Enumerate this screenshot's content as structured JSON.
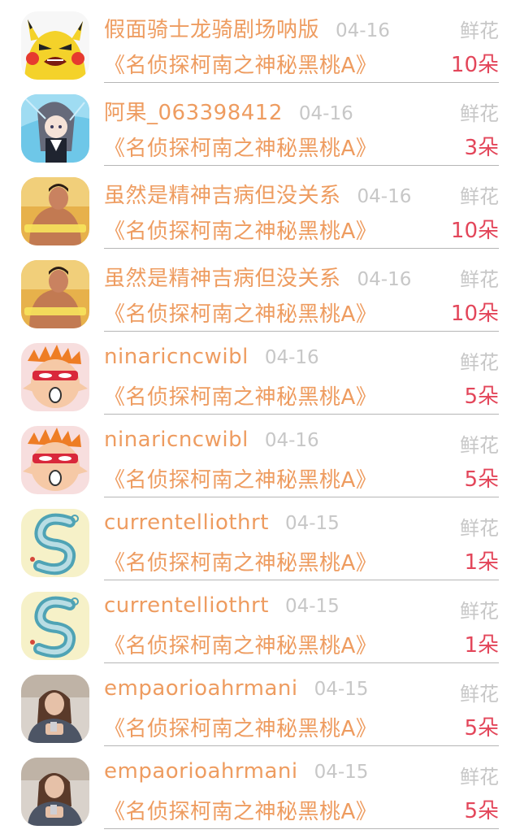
{
  "colors": {
    "accent_orange": "#ee9c60",
    "count_red": "#e3465a",
    "muted_gray": "#c7c7c7",
    "divider": "#b6b6b6"
  },
  "gifts": [
    {
      "user": "假面骑士龙骑剧场呐版",
      "date": "04-16",
      "gift": "鲜花",
      "work": "《名侦探柯南之神秘黑桃A》",
      "count": "10朵",
      "avatar_icon": "pikachu-avatar-icon"
    },
    {
      "user": "阿果_063398412",
      "date": "04-16",
      "gift": "鲜花",
      "work": "《名侦探柯南之神秘黑桃A》",
      "count": "3朵",
      "avatar_icon": "anime-girl-avatar-icon"
    },
    {
      "user": "虽然是精神吉病但没关系",
      "date": "04-16",
      "gift": "鲜花",
      "work": "《名侦探柯南之神秘黑桃A》",
      "count": "10朵",
      "avatar_icon": "man-photo-avatar-icon"
    },
    {
      "user": "虽然是精神吉病但没关系",
      "date": "04-16",
      "gift": "鲜花",
      "work": "《名侦探柯南之神秘黑桃A》",
      "count": "10朵",
      "avatar_icon": "man-photo-avatar-icon"
    },
    {
      "user": "ninaricncwibl",
      "date": "04-16",
      "gift": "鲜花",
      "work": "《名侦探柯南之神秘黑桃A》",
      "count": "5朵",
      "avatar_icon": "cartoon-face-avatar-icon"
    },
    {
      "user": "ninaricncwibl",
      "date": "04-16",
      "gift": "鲜花",
      "work": "《名侦探柯南之神秘黑桃A》",
      "count": "5朵",
      "avatar_icon": "cartoon-face-avatar-icon"
    },
    {
      "user": "currentelliothrt",
      "date": "04-15",
      "gift": "鲜花",
      "work": "《名侦探柯南之神秘黑桃A》",
      "count": "1朵",
      "avatar_icon": "letter-s-avatar-icon"
    },
    {
      "user": "currentelliothrt",
      "date": "04-15",
      "gift": "鲜花",
      "work": "《名侦探柯南之神秘黑桃A》",
      "count": "1朵",
      "avatar_icon": "letter-s-avatar-icon"
    },
    {
      "user": "empaorioahrmani",
      "date": "04-15",
      "gift": "鲜花",
      "work": "《名侦探柯南之神秘黑桃A》",
      "count": "5朵",
      "avatar_icon": "woman-photo-avatar-icon"
    },
    {
      "user": "empaorioahrmani",
      "date": "04-15",
      "gift": "鲜花",
      "work": "《名侦探柯南之神秘黑桃A》",
      "count": "5朵",
      "avatar_icon": "woman-photo-avatar-icon"
    }
  ]
}
